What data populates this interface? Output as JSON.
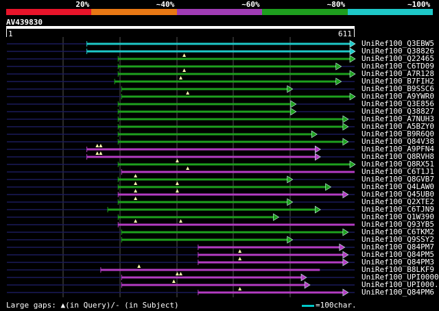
{
  "scale": {
    "segments": [
      {
        "color": "#e8142a",
        "label": "20%"
      },
      {
        "color": "#e87814",
        "label": "~40%"
      },
      {
        "color": "#a03cb4",
        "label": "~60%"
      },
      {
        "color": "#1e9e1e",
        "label": "~80%"
      },
      {
        "color": "#1ec8c8",
        "label": "~100%"
      }
    ]
  },
  "query": {
    "id": "AV439830",
    "start_label": "1",
    "end_label": "611",
    "length": 611
  },
  "footer": {
    "gaps_text": "Large gaps: ▲(in Query)/- (in Subject)",
    "legend_text": "=100char."
  },
  "colors": {
    "cyan": "#1ec8c8",
    "green": "#1ea01e",
    "purple": "#b43cc3",
    "line": "#1a1a5a"
  },
  "hits": [
    {
      "name": "UniRef100_Q3EBW5",
      "color": "cyan",
      "start": 0.23,
      "end": 1.0,
      "arrow": true,
      "gaps": []
    },
    {
      "name": "UniRef100_Q38826",
      "color": "cyan",
      "start": 0.23,
      "end": 1.0,
      "arrow": true,
      "gaps": []
    },
    {
      "name": "UniRef100_Q22465",
      "color": "green",
      "start": 0.32,
      "end": 1.0,
      "arrow": true,
      "gaps": [
        0.51
      ]
    },
    {
      "name": "UniRef100_C6TD09",
      "color": "green",
      "start": 0.32,
      "end": 0.96,
      "arrow": true,
      "gaps": []
    },
    {
      "name": "UniRef100_A7R128",
      "color": "green",
      "start": 0.32,
      "end": 1.0,
      "arrow": true,
      "gaps": [
        0.51
      ]
    },
    {
      "name": "UniRef100_B7FIH2",
      "color": "green",
      "start": 0.31,
      "end": 0.96,
      "arrow": true,
      "gaps": [
        0.5
      ]
    },
    {
      "name": "UniRef100_B9SSC6",
      "color": "green",
      "start": 0.33,
      "end": 0.82,
      "arrow": true,
      "gaps": []
    },
    {
      "name": "UniRef100_A9YWR0",
      "color": "green",
      "start": 0.33,
      "end": 1.0,
      "arrow": true,
      "gaps": [
        0.52
      ]
    },
    {
      "name": "UniRef100_Q3E856",
      "color": "green",
      "start": 0.32,
      "end": 0.83,
      "arrow": true,
      "gaps": []
    },
    {
      "name": "UniRef100_Q38827",
      "color": "green",
      "start": 0.32,
      "end": 0.83,
      "arrow": true,
      "gaps": []
    },
    {
      "name": "UniRef100_A7NUH3",
      "color": "green",
      "start": 0.32,
      "end": 0.98,
      "arrow": true,
      "gaps": []
    },
    {
      "name": "UniRef100_A5BZY0",
      "color": "green",
      "start": 0.32,
      "end": 0.98,
      "arrow": true,
      "gaps": []
    },
    {
      "name": "UniRef100_B9R6Q0",
      "color": "green",
      "start": 0.32,
      "end": 0.89,
      "arrow": true,
      "gaps": []
    },
    {
      "name": "UniRef100_Q84V38",
      "color": "green",
      "start": 0.32,
      "end": 0.98,
      "arrow": true,
      "gaps": []
    },
    {
      "name": "UniRef100_A9PFN4",
      "color": "purple",
      "start": 0.23,
      "end": 0.9,
      "arrow": true,
      "gaps": [
        0.26,
        0.27
      ]
    },
    {
      "name": "UniRef100_Q8RVH8",
      "color": "purple",
      "start": 0.23,
      "end": 0.9,
      "arrow": true,
      "gaps": [
        0.26,
        0.27
      ]
    },
    {
      "name": "UniRef100_Q8RX51",
      "color": "green",
      "start": 0.32,
      "end": 1.0,
      "arrow": true,
      "gaps": [
        0.49
      ]
    },
    {
      "name": "UniRef100_C6T1J1",
      "color": "purple",
      "start": 0.33,
      "end": 1.0,
      "arrow": false,
      "gaps": [
        0.52
      ]
    },
    {
      "name": "UniRef100_Q8GVB7",
      "color": "green",
      "start": 0.32,
      "end": 0.82,
      "arrow": true,
      "gaps": [
        0.37
      ]
    },
    {
      "name": "UniRef100_Q4LAW0",
      "color": "green",
      "start": 0.32,
      "end": 0.93,
      "arrow": true,
      "gaps": [
        0.37,
        0.49
      ]
    },
    {
      "name": "UniRef100_Q45UB0",
      "color": "purple",
      "start": 0.32,
      "end": 0.98,
      "arrow": true,
      "gaps": [
        0.37,
        0.49
      ]
    },
    {
      "name": "UniRef100_Q2XTE2",
      "color": "green",
      "start": 0.32,
      "end": 0.82,
      "arrow": true,
      "gaps": [
        0.37
      ]
    },
    {
      "name": "UniRef100_C6TJN9",
      "color": "green",
      "start": 0.29,
      "end": 0.9,
      "arrow": true,
      "gaps": []
    },
    {
      "name": "UniRef100_Q1W390",
      "color": "green",
      "start": 0.32,
      "end": 0.78,
      "arrow": true,
      "gaps": []
    },
    {
      "name": "UniRef100_Q93YB5",
      "color": "purple",
      "start": 0.32,
      "end": 1.0,
      "arrow": false,
      "gaps": [
        0.37,
        0.5
      ]
    },
    {
      "name": "UniRef100_C6TKM2",
      "color": "green",
      "start": 0.33,
      "end": 0.98,
      "arrow": true,
      "gaps": []
    },
    {
      "name": "UniRef100_Q9SSY2",
      "color": "green",
      "start": 0.33,
      "end": 0.82,
      "arrow": true,
      "gaps": []
    },
    {
      "name": "UniRef100_Q84PM7",
      "color": "purple",
      "start": 0.55,
      "end": 0.97,
      "arrow": true,
      "gaps": []
    },
    {
      "name": "UniRef100_Q84PM5",
      "color": "purple",
      "start": 0.55,
      "end": 0.98,
      "arrow": true,
      "gaps": [
        0.67
      ]
    },
    {
      "name": "UniRef100_Q84PM3",
      "color": "purple",
      "start": 0.55,
      "end": 0.98,
      "arrow": true,
      "gaps": [
        0.67
      ]
    },
    {
      "name": "UniRef100_B8LKF9",
      "color": "purple",
      "start": 0.27,
      "end": 0.9,
      "arrow": false,
      "gaps": [
        0.38
      ]
    },
    {
      "name": "UniRef100_UPI0000...",
      "color": "purple",
      "start": 0.33,
      "end": 0.86,
      "arrow": true,
      "gaps": [
        0.49,
        0.5
      ]
    },
    {
      "name": "UniRef100_UPI000...",
      "color": "purple",
      "start": 0.33,
      "end": 0.87,
      "arrow": true,
      "gaps": [
        0.48
      ]
    },
    {
      "name": "UniRef100_Q84PM6",
      "color": "purple",
      "start": 0.55,
      "end": 0.98,
      "arrow": true,
      "gaps": [
        0.67
      ]
    }
  ]
}
